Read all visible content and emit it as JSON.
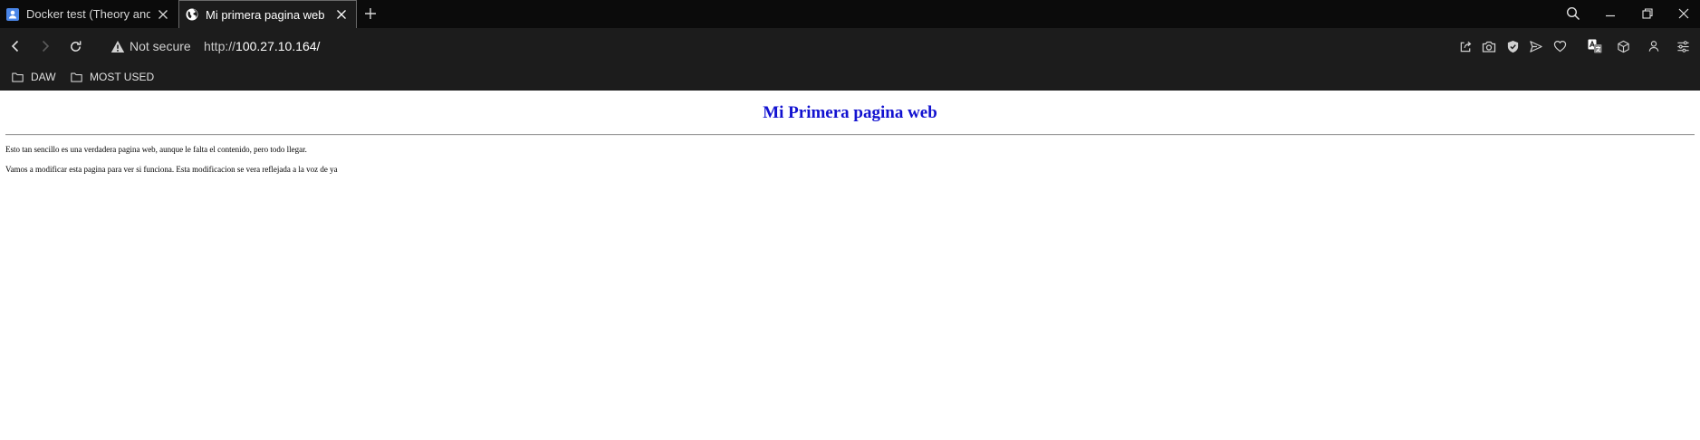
{
  "tabs": [
    {
      "title": "Docker test (Theory and Pr",
      "favicon": "docs-icon",
      "active": false
    },
    {
      "title": "Mi primera pagina web",
      "favicon": "globe-icon",
      "active": true
    }
  ],
  "address_bar": {
    "security_label": "Not secure",
    "url_protocol": "http://",
    "url_host": "100.27.10.164/"
  },
  "bookmarks": [
    {
      "label": "DAW",
      "icon": "folder-icon"
    },
    {
      "label": "MOST USED",
      "icon": "folder-icon"
    }
  ],
  "page": {
    "heading": "Mi Primera pagina web",
    "paragraphs": [
      "Esto tan sencillo es una verdadera pagina web, aunque le falta el contenido, pero todo llegar.",
      "Vamos a modificar esta pagina para ver si funciona. Esta modificacion se vera reflejada a la voz de ya"
    ],
    "heading_color": "#1212d0"
  },
  "theme": {
    "chrome_bg": "#0b0b0b",
    "toolbar_bg": "#1c1c1c",
    "docs_blue": "#4a86e8"
  }
}
